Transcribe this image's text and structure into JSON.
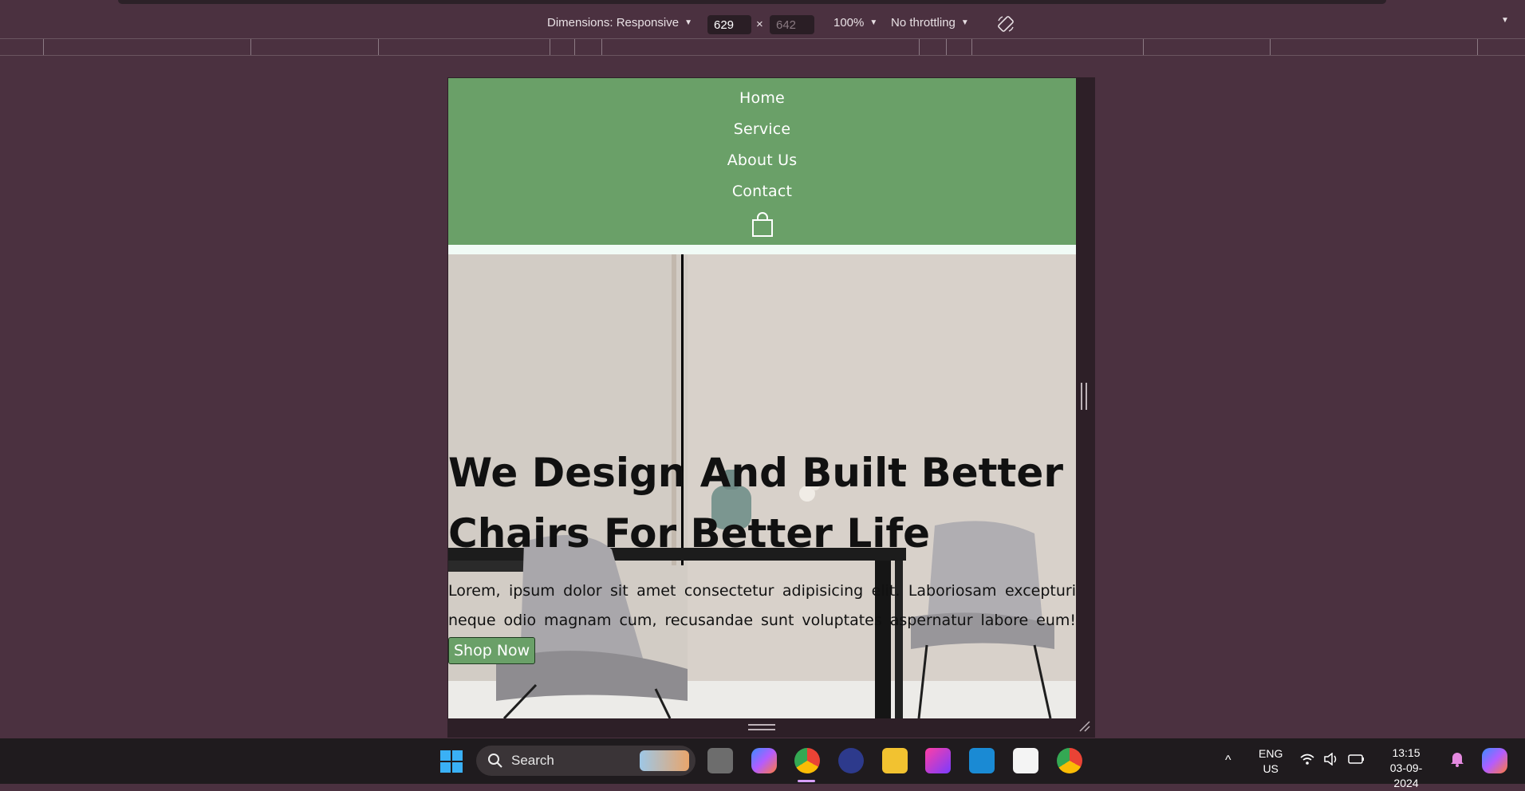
{
  "devtools": {
    "dimensions_label": "Dimensions: Responsive",
    "width": "629",
    "height": "642",
    "times": "×",
    "zoom": "100%",
    "throttling": "No throttling"
  },
  "site": {
    "nav_items": [
      "Home",
      "Service",
      "About Us",
      "Contact"
    ],
    "cart_icon": "shopping-bag-icon",
    "hero": {
      "heading": "We Design And Built Better Chairs For Better Life",
      "body": "Lorem, ipsum dolor sit amet consectetur adipisicing elit. Laboriosam excepturi neque odio magnam cum, recusandae sunt voluptates aspernatur labore eum!",
      "cta": "Shop Now"
    },
    "colors": {
      "nav": "#6aa068",
      "button": "#6aa068"
    }
  },
  "taskbar": {
    "search_label": "Search",
    "lang_line1": "ENG",
    "lang_line2": "US",
    "time": "13:15",
    "date": "03-09-2024"
  }
}
